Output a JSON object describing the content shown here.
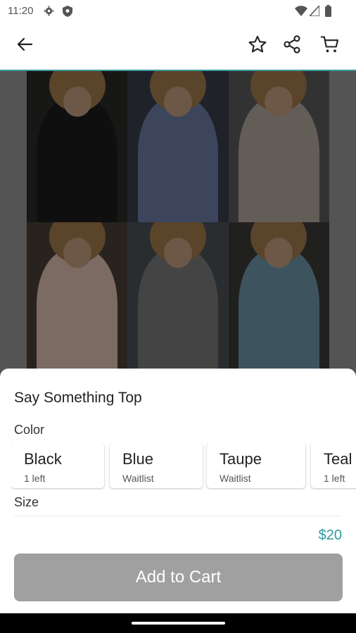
{
  "status_bar": {
    "time": "11:20",
    "left_icons": [
      "gear-icon",
      "shield-icon"
    ],
    "right_icons": [
      "wifi-icon",
      "signal-icon",
      "battery-icon"
    ]
  },
  "toolbar": {
    "back_icon": "arrow-left-icon",
    "favorite_icon": "star-outline-icon",
    "share_icon": "share-icon",
    "cart_icon": "cart-icon",
    "accent_color": "#3a9a9b"
  },
  "product": {
    "title": "Say Something Top",
    "image_colors": [
      "#1c1c1c",
      "#6f7fa8",
      "#b5aaa0",
      "#e2c4b3",
      "#7c7c7f",
      "#6f97ab"
    ]
  },
  "color_section": {
    "label": "Color",
    "options": [
      {
        "name": "Black",
        "stock": "1 left"
      },
      {
        "name": "Blue",
        "stock": "Waitlist"
      },
      {
        "name": "Taupe",
        "stock": "Waitlist"
      },
      {
        "name": "Teal",
        "stock": "1 left"
      }
    ]
  },
  "size_section": {
    "label": "Size"
  },
  "purchase": {
    "price": "$20",
    "price_color": "#2a9a9c",
    "add_to_cart_label": "Add to Cart",
    "button_color": "#a0a0a0"
  }
}
